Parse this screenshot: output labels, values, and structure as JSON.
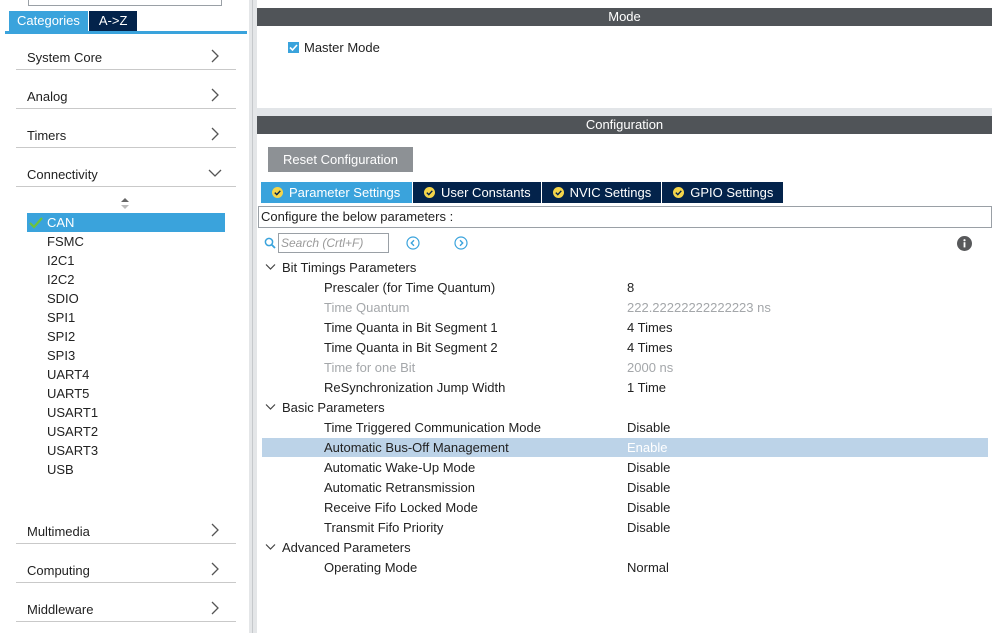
{
  "left_panel": {
    "tabs": {
      "categories": "Categories",
      "az": "A->Z"
    },
    "categories": [
      {
        "label": "System Core",
        "expanded": false
      },
      {
        "label": "Analog",
        "expanded": false
      },
      {
        "label": "Timers",
        "expanded": false
      },
      {
        "label": "Connectivity",
        "expanded": true
      },
      {
        "label": "Multimedia",
        "expanded": false
      },
      {
        "label": "Computing",
        "expanded": false
      },
      {
        "label": "Middleware",
        "expanded": false
      }
    ],
    "connectivity_items": [
      "CAN",
      "FSMC",
      "I2C1",
      "I2C2",
      "SDIO",
      "SPI1",
      "SPI2",
      "SPI3",
      "UART4",
      "UART5",
      "USART1",
      "USART2",
      "USART3",
      "USB"
    ],
    "selected_item": "CAN"
  },
  "mode": {
    "title": "Mode",
    "master_mode": {
      "label": "Master Mode",
      "checked": true
    }
  },
  "configuration": {
    "title": "Configuration",
    "reset_button": "Reset Configuration",
    "tabs": [
      "Parameter Settings",
      "User Constants",
      "NVIC Settings",
      "GPIO Settings"
    ],
    "active_tab": "Parameter Settings",
    "description": "Configure the below parameters :",
    "search_placeholder": "Search (Crtl+F)",
    "groups": [
      {
        "label": "Bit Timings Parameters",
        "params": [
          {
            "name": "Prescaler (for Time Quantum)",
            "value": "8",
            "readonly": false
          },
          {
            "name": "Time Quantum",
            "value": "222.22222222222223 ns",
            "readonly": true
          },
          {
            "name": "Time Quanta in Bit Segment 1",
            "value": "4 Times",
            "readonly": false
          },
          {
            "name": "Time Quanta in Bit Segment 2",
            "value": "4 Times",
            "readonly": false
          },
          {
            "name": "Time for one Bit",
            "value": "2000 ns",
            "readonly": true
          },
          {
            "name": "ReSynchronization Jump Width",
            "value": "1 Time",
            "readonly": false
          }
        ]
      },
      {
        "label": "Basic Parameters",
        "params": [
          {
            "name": "Time Triggered Communication Mode",
            "value": "Disable",
            "readonly": false
          },
          {
            "name": "Automatic Bus-Off Management",
            "value": "Enable",
            "readonly": false,
            "selected": true
          },
          {
            "name": "Automatic Wake-Up Mode",
            "value": "Disable",
            "readonly": false
          },
          {
            "name": "Automatic Retransmission",
            "value": "Disable",
            "readonly": false
          },
          {
            "name": "Receive Fifo Locked Mode",
            "value": "Disable",
            "readonly": false
          },
          {
            "name": "Transmit Fifo Priority",
            "value": "Disable",
            "readonly": false
          }
        ]
      },
      {
        "label": "Advanced Parameters",
        "params": [
          {
            "name": "Operating Mode",
            "value": "Normal",
            "readonly": false
          }
        ]
      }
    ]
  },
  "colors": {
    "accent": "#3aa3dc",
    "dark_navy": "#03234b",
    "header_bar": "#505458",
    "selection_row": "#bcd3e8",
    "disabled_text": "#a4a7aa"
  }
}
